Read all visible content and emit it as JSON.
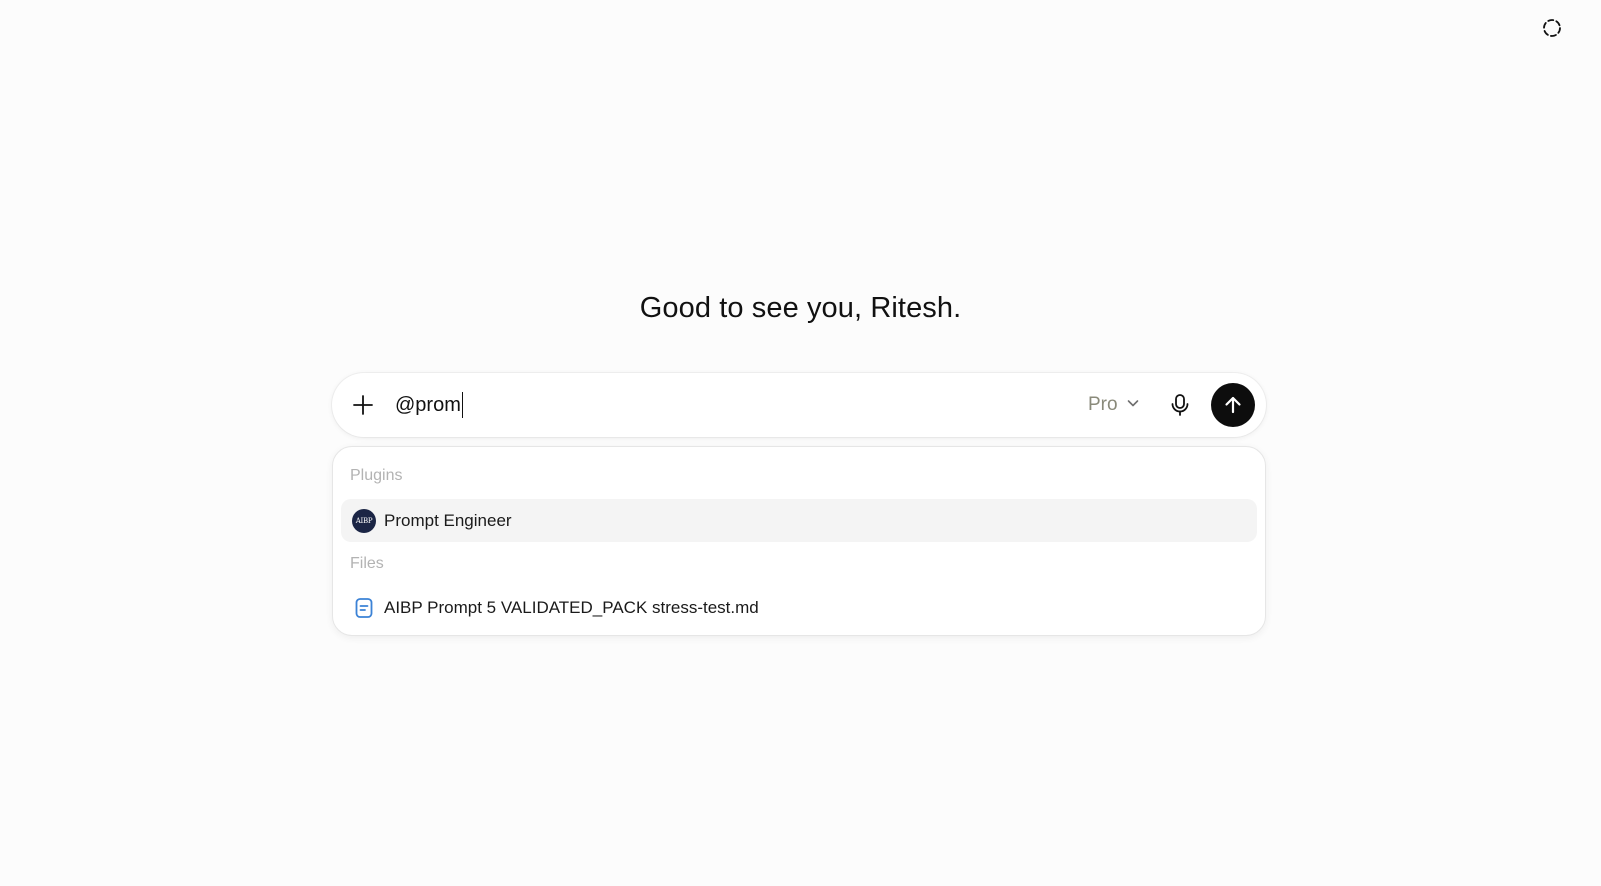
{
  "header": {
    "corner_icon": "dashed-circle-icon"
  },
  "greeting": "Good to see you, Ritesh.",
  "composer": {
    "plus_icon": "plus-icon",
    "input_value": "@prom",
    "model_label": "Pro",
    "model_chevron_icon": "chevron-down-icon",
    "mic_icon": "microphone-icon",
    "send_icon": "arrow-up-icon"
  },
  "suggestions": {
    "plugins_label": "Plugins",
    "plugins": [
      {
        "label": "Prompt Engineer",
        "avatar_text": "AIBP",
        "icon": "plugin-avatar"
      }
    ],
    "files_label": "Files",
    "files": [
      {
        "label": "AIBP Prompt 5 VALIDATED_PACK stress-test.md",
        "icon": "document-icon"
      }
    ]
  },
  "colors": {
    "background": "#fcfcfc",
    "send_button": "#0d0d0d",
    "plugin_avatar": "#1b2545",
    "file_icon": "#3b82d6",
    "active_item": "#f4f4f4"
  }
}
